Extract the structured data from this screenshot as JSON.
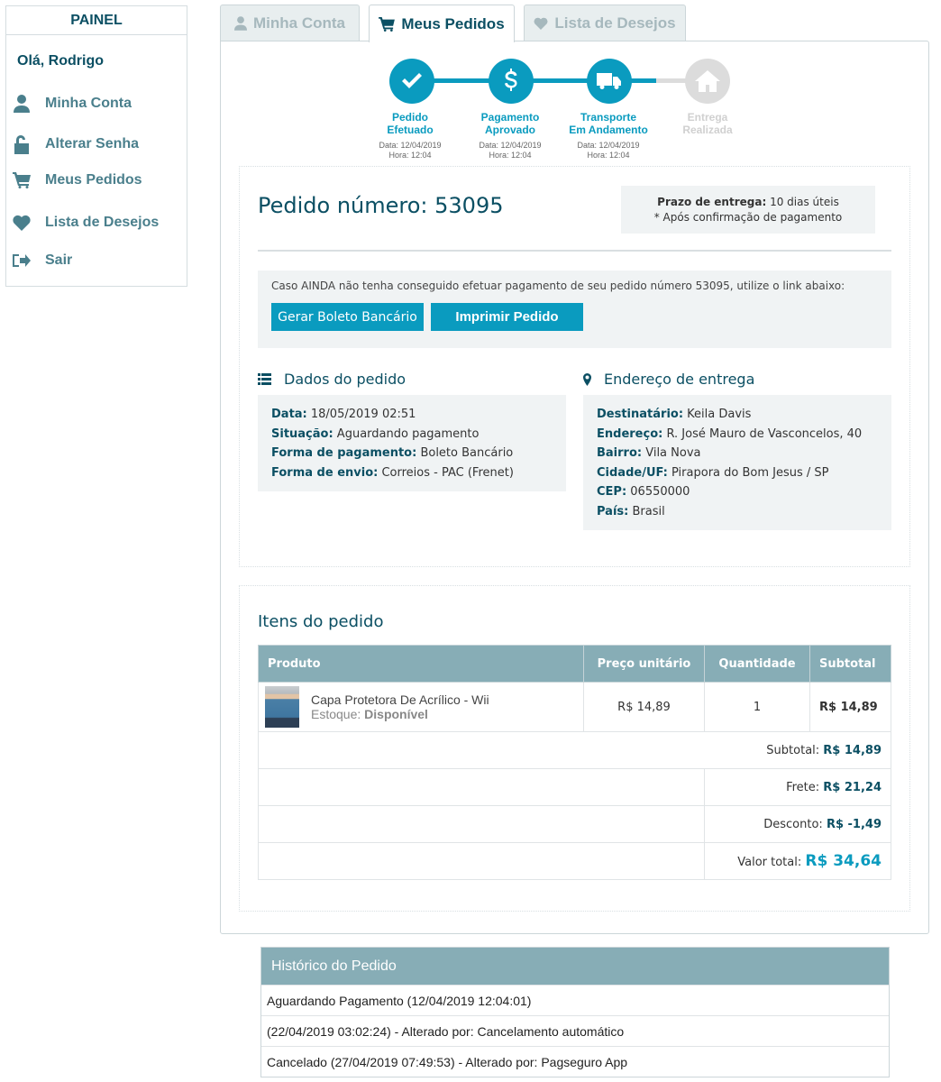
{
  "sidebar": {
    "title": "PAINEL",
    "greeting": "Olá, Rodrigo",
    "items": [
      {
        "label": "Minha Conta",
        "icon": "user-icon"
      },
      {
        "label": "Alterar Senha",
        "icon": "unlock-icon"
      },
      {
        "label": "Meus Pedidos",
        "icon": "cart-icon"
      },
      {
        "label": "Lista de Desejos",
        "icon": "heart-icon"
      },
      {
        "label": "Sair",
        "icon": "sign-out-icon"
      }
    ]
  },
  "tabs": [
    {
      "label": "Minha Conta",
      "icon": "user-icon",
      "active": false
    },
    {
      "label": "Meus Pedidos",
      "icon": "cart-icon",
      "active": true
    },
    {
      "label": "Lista de Desejos",
      "icon": "heart-icon",
      "active": false
    }
  ],
  "progress": [
    {
      "label": "Pedido\nEfetuado",
      "date": "Data: 12/04/2019",
      "time": "Hora: 12:04",
      "icon": "check-icon",
      "done": true
    },
    {
      "label": "Pagamento\nAprovado",
      "date": "Data: 12/04/2019",
      "time": "Hora: 12:04",
      "icon": "dollar-icon",
      "done": true
    },
    {
      "label": "Transporte\nEm Andamento",
      "date": "Data: 12/04/2019",
      "time": "Hora: 12:04",
      "icon": "truck-icon",
      "done": true
    },
    {
      "label": "Entrega\nRealizada",
      "date": "",
      "time": "",
      "icon": "home-icon",
      "done": false
    }
  ],
  "order": {
    "title": "Pedido número: 53095",
    "delivery_label": "Prazo de entrega:",
    "delivery_value": " 10 dias úteis",
    "delivery_note": "* Após confirmação de pagamento",
    "payment_notice": "Caso AINDA não tenha conseguido efetuar pagamento de seu pedido número 53095, utilize o link abaixo:",
    "btn_boleto": "Gerar Boleto Bancário",
    "btn_print": "Imprimir Pedido"
  },
  "details": {
    "title": "Dados do pedido",
    "rows": [
      {
        "k": "Data:",
        "v": " 18/05/2019 02:51"
      },
      {
        "k": "Situação:",
        "v": " Aguardando pagamento"
      },
      {
        "k": "Forma de pagamento:",
        "v": " Boleto Bancário"
      },
      {
        "k": "Forma de envio:",
        "v": " Correios - PAC (Frenet)"
      }
    ]
  },
  "address": {
    "title": "Endereço de entrega",
    "rows": [
      {
        "k": "Destinatário:",
        "v": " Keila Davis"
      },
      {
        "k": "Endereço:",
        "v": " R. José Mauro de Vasconcelos, 40"
      },
      {
        "k": "Bairro:",
        "v": " Vila Nova"
      },
      {
        "k": "Cidade/UF:",
        "v": " Pirapora do Bom Jesus / SP"
      },
      {
        "k": "CEP:",
        "v": " 06550000"
      },
      {
        "k": "País:",
        "v": " Brasil"
      }
    ]
  },
  "items": {
    "title": "Itens do pedido",
    "headers": [
      "Produto",
      "Preço unitário",
      "Quantidade",
      "Subtotal"
    ],
    "rows": [
      {
        "name": "Capa Protetora De Acrílico - Wii",
        "stock_label": "Estoque:",
        "stock_value": "Disponível",
        "price": "R$ 14,89",
        "qty": "1",
        "subtotal": "R$ 14,89"
      }
    ],
    "summary": [
      {
        "label": "Subtotal:",
        "value": "R$ 14,89"
      },
      {
        "label": "Frete:",
        "value": "R$ 21,24"
      },
      {
        "label": "Desconto:",
        "value": "R$ -1,49"
      }
    ],
    "total_label": "Valor total:",
    "total_value": "R$ 34,64"
  },
  "history": {
    "title": "Histórico do Pedido",
    "rows": [
      "Aguardando Pagamento (12/04/2019 12:04:01)",
      "(22/04/2019 03:02:24) - Alterado por: Cancelamento automático",
      "Cancelado (27/04/2019 07:49:53) - Alterado por: Pagseguro App"
    ]
  },
  "colors": {
    "accent": "#0a9bbf",
    "dark": "#0b4f63",
    "header": "#87adb6",
    "inactive": "#dcdcdc"
  }
}
